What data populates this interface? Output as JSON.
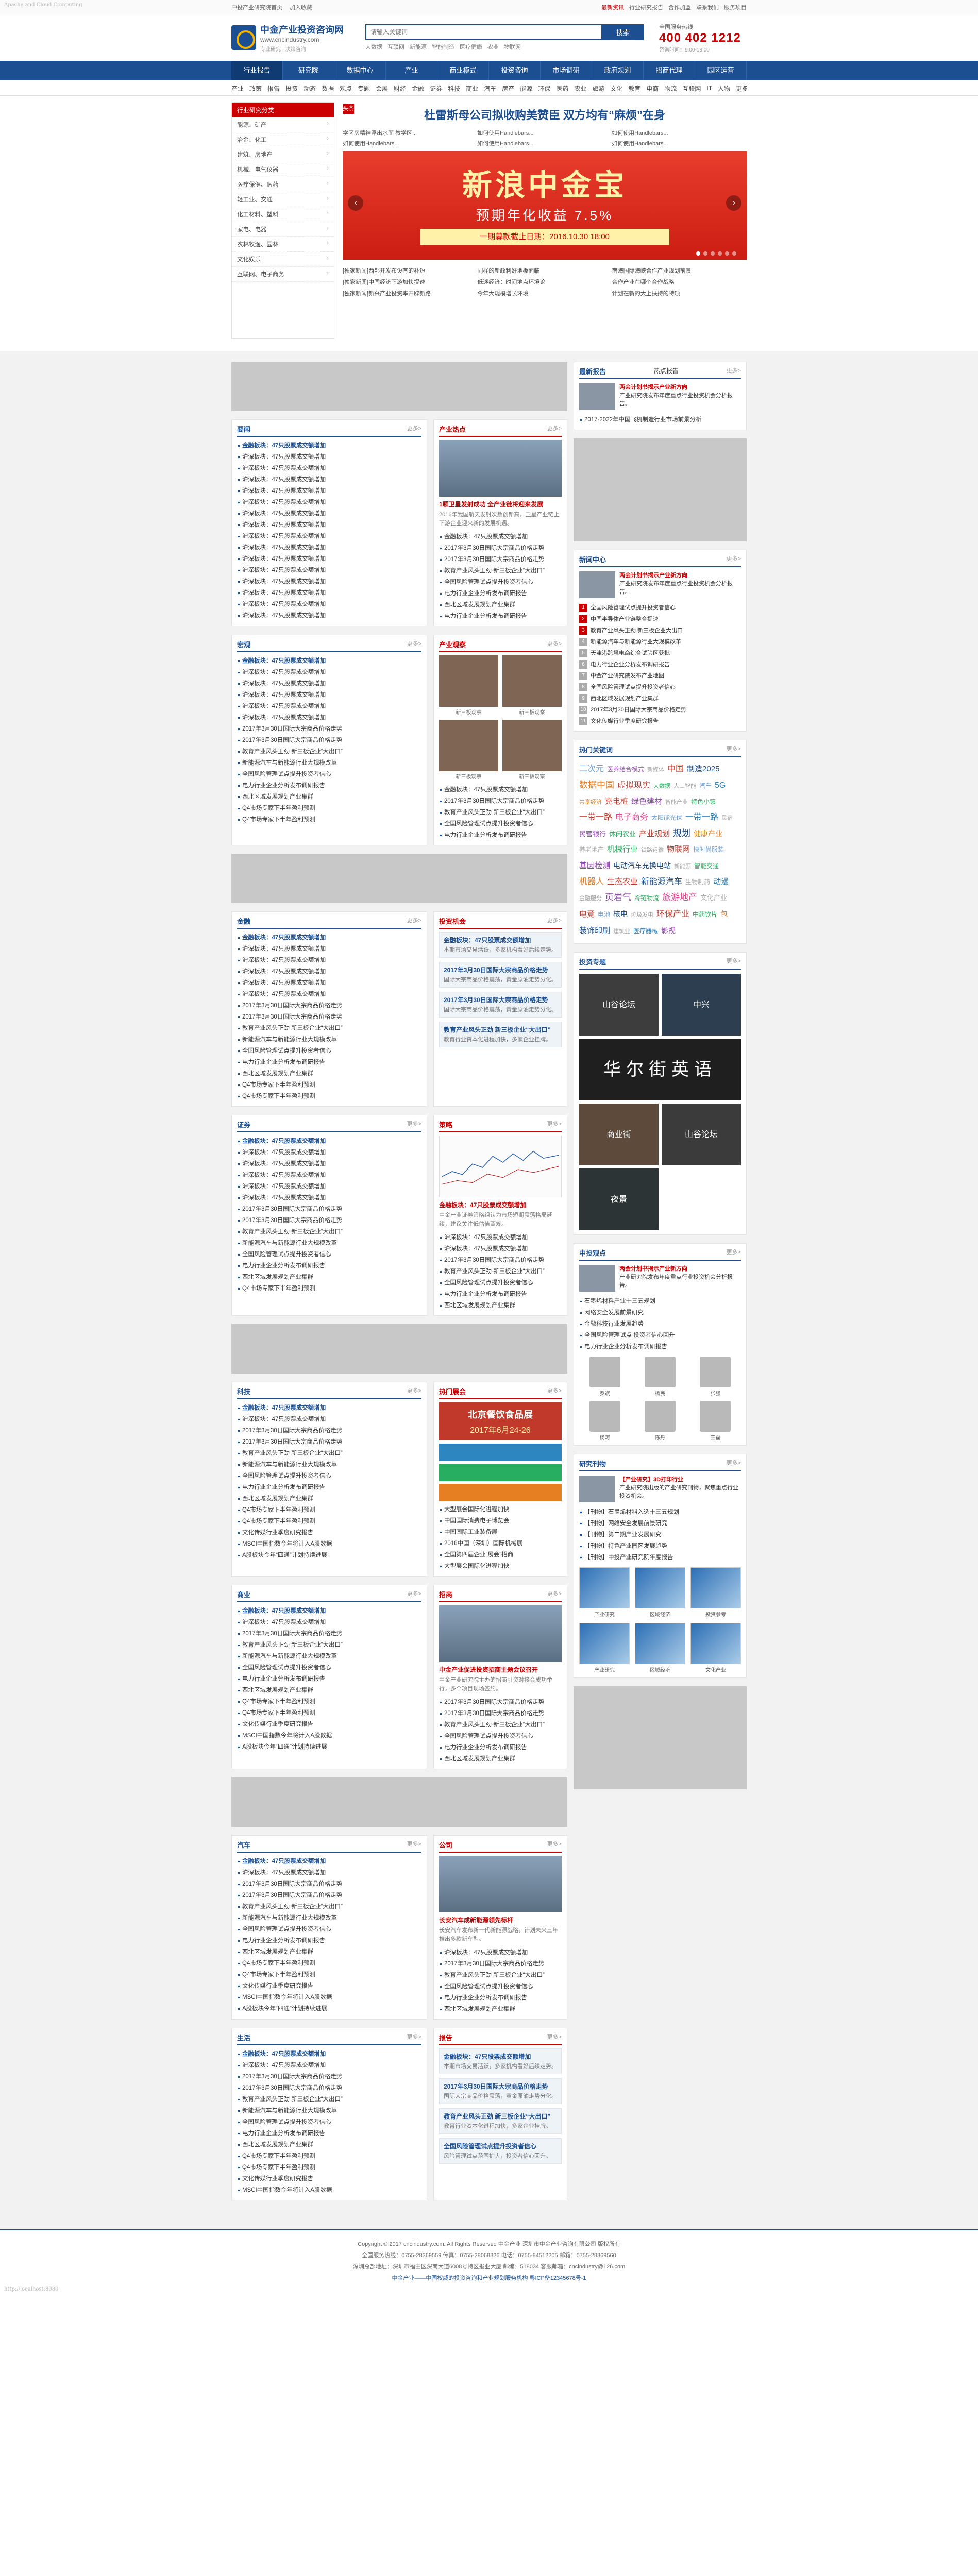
{
  "corner_label": "Apache and Cloud Computing",
  "topbar": {
    "left": [
      "中投产业研究院首页",
      "加入收藏"
    ],
    "right": [
      "最新资讯",
      "行业研究报告",
      "合作加盟",
      "联系我们",
      "服务项目"
    ]
  },
  "header": {
    "logo_title": "中金产业投资咨询网",
    "logo_sub": "www.cncindustry.com",
    "logo_slogan": "专业研究 · 决策咨询",
    "search_placeholder": "请输入关键词",
    "search_button": "搜索",
    "hot_words": [
      "大数据",
      "互联网",
      "新能源",
      "智能制造",
      "医疗健康",
      "农业",
      "物联网"
    ],
    "hotline_label": "全国服务热线",
    "hotline_number": "400 402 1212",
    "hotline_sub": "咨询时间：9:00-18:00"
  },
  "nav": [
    "行业报告",
    "研究院",
    "数据中心",
    "产业",
    "商业模式",
    "投资咨询",
    "市场调研",
    "政府规划",
    "招商代理",
    "园区运营"
  ],
  "subnav": [
    "产业",
    "政策",
    "报告",
    "投资",
    "动态",
    "数据",
    "观点",
    "专题",
    "会展",
    "财经",
    "金融",
    "证券",
    "科技",
    "商业",
    "汽车",
    "房产",
    "能源",
    "环保",
    "医药",
    "农业",
    "旅游",
    "文化",
    "教育",
    "电商",
    "物流",
    "互联网",
    "IT",
    "人物",
    "更多"
  ],
  "category": {
    "head": "行业研究分类",
    "items": [
      "能源、矿产",
      "冶金、化工",
      "建筑、房地产",
      "机械、电气仪器",
      "医疗保健、医药",
      "轻工业、交通",
      "化工材料、塑料",
      "家电、电器",
      "农林牧渔、园林",
      "文化娱乐",
      "互联网、电子商务"
    ]
  },
  "focus": {
    "tag": "头条",
    "headline": "杜雷斯母公司拟收购美赞臣 双方均有“麻烦”在身",
    "links": [
      "学区房精神浮出水面 教学区...",
      "如何使用Handlebars...",
      "如何使用Handlebars...",
      "如何使用Handlebars...",
      "如何使用Handlebars...",
      "如何使用Handlebars..."
    ],
    "banner_title": "新浪中金宝",
    "banner_sub": "预期年化收益 7.5%",
    "banner_strip": "一期募款截止日期：2016.10.30 18:00",
    "bottom_tag": "[独家新闻]",
    "bottom_col1": [
      "[独家新闻]西部开发布设有的补短",
      "[独家新闻]中国经济下游加快提速",
      "[独家新闻]新兴产业投资率开辟新路"
    ],
    "bottom_col2": [
      "同样的新政利好地板面临",
      "低迷经济：时间地点环境论",
      "今年大规模增长环境"
    ],
    "bottom_col3": [
      "南海国际海峡合作产业规划前景",
      "合作产业在哪个合作战略",
      "计划在新的大上扶持的特项"
    ]
  },
  "sections": [
    {
      "title": "要闻",
      "more": "更多>",
      "items": [
        "金融板块：47只股票成交额增加",
        "沪深板块：47只股票成交额增加",
        "沪深板块：47只股票成交额增加",
        "沪深板块：47只股票成交额增加",
        "沪深板块：47只股票成交额增加",
        "沪深板块：47只股票成交额增加",
        "沪深板块：47只股票成交额增加",
        "沪深板块：47只股票成交额增加",
        "沪深板块：47只股票成交额增加",
        "沪深板块：47只股票成交额增加",
        "沪深板块：47只股票成交额增加",
        "沪深板块：47只股票成交额增加",
        "沪深板块：47只股票成交额增加",
        "沪深板块：47只股票成交额增加",
        "沪深板块：47只股票成交额增加",
        "沪深板块：47只股票成交额增加"
      ],
      "side_title": "产业热点",
      "side_type": "pic",
      "side_cap": "1颗卫星发射成功 全产业链将迎来发展",
      "side_desc": "2016年我国航天发射次数创新高，卫星产业链上下游企业迎来新的发展机遇。",
      "side_items": [
        "金融板块：47只股票成交额增加",
        "2017年3月30日国际大宗商品价格走势",
        "2017年3月30日国际大宗商品价格走势",
        "教育产业风头正劲 新三板企业“大出口”",
        "全国风险管理试点提升投资者信心",
        "电力行业企业分析发布调研报告",
        "西北区域发展规划产业集群",
        "电力行业企业分析发布调研报告"
      ]
    },
    {
      "title": "宏观",
      "more": "更多>",
      "items": [
        "金融板块：47只股票成交额增加",
        "沪深板块：47只股票成交额增加",
        "沪深板块：47只股票成交额增加",
        "沪深板块：47只股票成交额增加",
        "沪深板块：47只股票成交额增加",
        "沪深板块：47只股票成交额增加",
        "2017年3月30日国际大宗商品价格走势",
        "2017年3月30日国际大宗商品价格走势",
        "教育产业风头正劲 新三板企业“大出口”",
        "新能源汽车与新能源行业大规模改革",
        "全国风险管理试点提升投资者信心",
        "电力行业企业分析发布调研报告",
        "西北区域发展规划产业集群",
        "Q4市场专家下半年盈利预测",
        "Q4市场专家下半年盈利预测"
      ],
      "side_title": "产业观察",
      "side_type": "thumbs",
      "thumb_caps": [
        "新三板观察",
        "新三板观察",
        "新三板观察",
        "新三板观察"
      ],
      "side_items": [
        "金融板块：47只股票成交额增加",
        "2017年3月30日国际大宗商品价格走势",
        "教育产业风头正劲 新三板企业“大出口”",
        "全国风险管理试点提升投资者信心",
        "电力行业企业分析发布调研报告"
      ]
    },
    {
      "title": "金融",
      "more": "更多>",
      "items": [
        "金融板块：47只股票成交额增加",
        "沪深板块：47只股票成交额增加",
        "沪深板块：47只股票成交额增加",
        "沪深板块：47只股票成交额增加",
        "沪深板块：47只股票成交额增加",
        "沪深板块：47只股票成交额增加",
        "2017年3月30日国际大宗商品价格走势",
        "2017年3月30日国际大宗商品价格走势",
        "教育产业风头正劲 新三板企业“大出口”",
        "新能源汽车与新能源行业大规模改革",
        "全国风险管理试点提升投资者信心",
        "电力行业企业分析发布调研报告",
        "西北区域发展规划产业集群",
        "Q4市场专家下半年盈利预测",
        "Q4市场专家下半年盈利预测"
      ],
      "side_title": "投资机会",
      "side_type": "biz",
      "biz": [
        {
          "t": "金融板块：47只股票成交额增加",
          "d": "本期市场交易活跃，多家机构看好后续走势。"
        },
        {
          "t": "2017年3月30日国际大宗商品价格走势",
          "d": "国际大宗商品价格震荡，黄金原油走势分化。"
        },
        {
          "t": "2017年3月30日国际大宗商品价格走势",
          "d": "国际大宗商品价格震荡，黄金原油走势分化。"
        },
        {
          "t": "教育产业风头正劲 新三板企业“大出口”",
          "d": "教育行业资本化进程加快，多家企业挂牌。"
        }
      ]
    },
    {
      "title": "证券",
      "more": "更多>",
      "items": [
        "金融板块：47只股票成交额增加",
        "沪深板块：47只股票成交额增加",
        "沪深板块：47只股票成交额增加",
        "沪深板块：47只股票成交额增加",
        "沪深板块：47只股票成交额增加",
        "沪深板块：47只股票成交额增加",
        "2017年3月30日国际大宗商品价格走势",
        "2017年3月30日国际大宗商品价格走势",
        "教育产业风头正劲 新三板企业“大出口”",
        "新能源汽车与新能源行业大规模改革",
        "全国风险管理试点提升投资者信心",
        "电力行业企业分析发布调研报告",
        "西北区域发展规划产业集群",
        "Q4市场专家下半年盈利预测"
      ],
      "side_title": "策略",
      "side_type": "chart",
      "side_cap": "金融板块：47只股票成交额增加",
      "side_desc": "中金产业证券策略组认为市场短期震荡格局延续，建议关注低估值蓝筹。",
      "side_items": [
        "沪深板块：47只股票成交额增加",
        "沪深板块：47只股票成交额增加",
        "2017年3月30日国际大宗商品价格走势",
        "教育产业风头正劲 新三板企业“大出口”",
        "全国风险管理试点提升投资者信心",
        "电力行业企业分析发布调研报告",
        "西北区域发展规划产业集群"
      ]
    },
    {
      "title": "科技",
      "more": "更多>",
      "items": [
        "金融板块：47只股票成交额增加",
        "沪深板块：47只股票成交额增加",
        "2017年3月30日国际大宗商品价格走势",
        "2017年3月30日国际大宗商品价格走势",
        "教育产业风头正劲 新三板企业“大出口”",
        "新能源汽车与新能源行业大规模改革",
        "全国风险管理试点提升投资者信心",
        "电力行业企业分析发布调研报告",
        "西北区域发展规划产业集群",
        "Q4市场专家下半年盈利预测",
        "Q4市场专家下半年盈利预测",
        "文化传媒行业季度研究报告",
        "MSCI中国指数今年将计入A股数据",
        "A股板块今年“四通”计划持续进展"
      ],
      "side_title": "热门展会",
      "side_type": "expo",
      "expo_title": "北京餐饮食品展",
      "expo_date": "2017年6月24-26",
      "side_items": [
        "大型展会国际化进程加快",
        "中国国际消费电子博览会",
        "中国国际工业装备展",
        "2016中国（深圳）国际机械展",
        "全国第四届企业“展会”招商",
        "大型展会国际化进程加快"
      ]
    },
    {
      "title": "商业",
      "more": "更多>",
      "items": [
        "金融板块：47只股票成交额增加",
        "沪深板块：47只股票成交额增加",
        "2017年3月30日国际大宗商品价格走势",
        "教育产业风头正劲 新三板企业“大出口”",
        "新能源汽车与新能源行业大规模改革",
        "全国风险管理试点提升投资者信心",
        "电力行业企业分析发布调研报告",
        "西北区域发展规划产业集群",
        "Q4市场专家下半年盈利预测",
        "Q4市场专家下半年盈利预测",
        "文化传媒行业季度研究报告",
        "MSCI中国指数今年将计入A股数据",
        "A股板块今年“四通”计划持续进展"
      ],
      "side_title": "招商",
      "side_type": "pic",
      "side_cap": "中金产业促进投资招商主题会议召开",
      "side_desc": "中金产业研究院主办的招商引资对接会成功举行，多个项目现场签约。",
      "side_items": [
        "2017年3月30日国际大宗商品价格走势",
        "2017年3月30日国际大宗商品价格走势",
        "教育产业风头正劲 新三板企业“大出口”",
        "全国风险管理试点提升投资者信心",
        "电力行业企业分析发布调研报告",
        "西北区域发展规划产业集群"
      ]
    },
    {
      "title": "汽车",
      "more": "更多>",
      "items": [
        "金融板块：47只股票成交额增加",
        "沪深板块：47只股票成交额增加",
        "2017年3月30日国际大宗商品价格走势",
        "2017年3月30日国际大宗商品价格走势",
        "教育产业风头正劲 新三板企业“大出口”",
        "新能源汽车与新能源行业大规模改革",
        "全国风险管理试点提升投资者信心",
        "电力行业企业分析发布调研报告",
        "西北区域发展规划产业集群",
        "Q4市场专家下半年盈利预测",
        "Q4市场专家下半年盈利预测",
        "文化传媒行业季度研究报告",
        "MSCI中国指数今年将计入A股数据",
        "A股板块今年“四通”计划持续进展"
      ],
      "side_title": "公司",
      "side_type": "pic",
      "side_cap": "长安汽车成新能源领先标杆",
      "side_desc": "长安汽车发布新一代新能源战略，计划未来三年推出多款新车型。",
      "side_items": [
        "沪深板块：47只股票成交额增加",
        "2017年3月30日国际大宗商品价格走势",
        "教育产业风头正劲 新三板企业“大出口”",
        "全国风险管理试点提升投资者信心",
        "电力行业企业分析发布调研报告",
        "西北区域发展规划产业集群"
      ]
    },
    {
      "title": "生活",
      "more": "更多>",
      "items": [
        "金融板块：47只股票成交额增加",
        "沪深板块：47只股票成交额增加",
        "2017年3月30日国际大宗商品价格走势",
        "2017年3月30日国际大宗商品价格走势",
        "教育产业风头正劲 新三板企业“大出口”",
        "新能源汽车与新能源行业大规模改革",
        "全国风险管理试点提升投资者信心",
        "电力行业企业分析发布调研报告",
        "西北区域发展规划产业集群",
        "Q4市场专家下半年盈利预测",
        "Q4市场专家下半年盈利预测",
        "文化传媒行业季度研究报告",
        "MSCI中国指数今年将计入A股数据"
      ],
      "side_title": "报告",
      "side_type": "biz",
      "biz": [
        {
          "t": "金融板块：47只股票成交额增加",
          "d": "本期市场交易活跃，多家机构看好后续走势。"
        },
        {
          "t": "2017年3月30日国际大宗商品价格走势",
          "d": "国际大宗商品价格震荡，黄金原油走势分化。"
        },
        {
          "t": "教育产业风头正劲 新三板企业“大出口”",
          "d": "教育行业资本化进程加快，多家企业挂牌。"
        },
        {
          "t": "全国风险管理试点提升投资者信心",
          "d": "风险管理试点范围扩大，投资者信心回升。"
        }
      ]
    }
  ],
  "right": {
    "report": {
      "title": "最新报告",
      "sub": "热点报告",
      "more": "更多>",
      "feature_title": "两会计划书揭示产业新方向",
      "feature_desc": "产业研究院发布年度重点行业投资机会分析报告。",
      "items": [
        "2017-2022年中国飞机制造行业市场前景分析"
      ]
    },
    "news_center": {
      "title": "新闻中心",
      "more": "更多>",
      "feature_title": "两会计划书揭示产业新方向",
      "feature_desc": "产业研究院发布年度重点行业投资机会分析报告。",
      "items": [
        "全国风险管理试点提升投资者信心",
        "中国半导体产业链整合提速",
        "教育产业风头正劲 新三板企业大出口",
        "新能源汽车与新能源行业大规模改革",
        "天津港跨境电商综合试验区获批",
        "电力行业企业分析发布调研报告",
        "中金产业研究院发布产业地图",
        "全国风险管理试点提升投资者信心",
        "西北区域发展规划产业集群",
        "2017年3月30日国际大宗商品价格走势",
        "文化传媒行业季度研究报告"
      ]
    },
    "tags": {
      "title": "热门关键词",
      "more": "更多>",
      "words": [
        {
          "w": "二次元",
          "s": 16,
          "c": "#6aa0d8"
        },
        {
          "w": "医养结合模式",
          "s": 12,
          "c": "#9b59b6"
        },
        {
          "w": "新媒体",
          "s": 11,
          "c": "#aaa"
        },
        {
          "w": "中国",
          "s": 16,
          "c": "#c0392b"
        },
        {
          "w": "制造2025",
          "s": 15,
          "c": "#1c4f91"
        },
        {
          "w": "数据中国",
          "s": 17,
          "c": "#e67e22"
        },
        {
          "w": "虚拟现实",
          "s": 16,
          "c": "#c0392b"
        },
        {
          "w": "大数据",
          "s": 11,
          "c": "#27ae60"
        },
        {
          "w": "人工智能",
          "s": 11,
          "c": "#999"
        },
        {
          "w": "汽车",
          "s": 12,
          "c": "#6aa0d8"
        },
        {
          "w": "5G",
          "s": 16,
          "c": "#2980b9"
        },
        {
          "w": "共享经济",
          "s": 11,
          "c": "#e67e22"
        },
        {
          "w": "充电桩",
          "s": 15,
          "c": "#c0392b"
        },
        {
          "w": "绿色建材",
          "s": 15,
          "c": "#8e44ad"
        },
        {
          "w": "智能产业",
          "s": 11,
          "c": "#aaa"
        },
        {
          "w": "特色小镇",
          "s": 12,
          "c": "#27ae60"
        },
        {
          "w": "一带一路",
          "s": 16,
          "c": "#c0392b"
        },
        {
          "w": "电子商务",
          "s": 16,
          "c": "#e84393"
        },
        {
          "w": "太阳能光伏",
          "s": 12,
          "c": "#6aa0d8"
        },
        {
          "w": "一带一路",
          "s": 16,
          "c": "#2980b9"
        },
        {
          "w": "民宿",
          "s": 11,
          "c": "#aaa"
        },
        {
          "w": "民营银行",
          "s": 13,
          "c": "#8e44ad"
        },
        {
          "w": "休闲农业",
          "s": 13,
          "c": "#27ae60"
        },
        {
          "w": "产业规划",
          "s": 15,
          "c": "#c0392b"
        },
        {
          "w": "规划",
          "s": 17,
          "c": "#1c4f91"
        },
        {
          "w": "健康产业",
          "s": 14,
          "c": "#e67e22"
        },
        {
          "w": "养老地产",
          "s": 12,
          "c": "#aaa"
        },
        {
          "w": "机械行业",
          "s": 15,
          "c": "#27ae60"
        },
        {
          "w": "铁路运输",
          "s": 11,
          "c": "#999"
        },
        {
          "w": "物联网",
          "s": 15,
          "c": "#c0392b"
        },
        {
          "w": "快时尚服装",
          "s": 12,
          "c": "#6aa0d8"
        },
        {
          "w": "基因检测",
          "s": 15,
          "c": "#8e44ad"
        },
        {
          "w": "电动汽车充换电站",
          "s": 14,
          "c": "#1c4f91"
        },
        {
          "w": "新能源",
          "s": 11,
          "c": "#aaa"
        },
        {
          "w": "智能交通",
          "s": 12,
          "c": "#27ae60"
        },
        {
          "w": "机器人",
          "s": 16,
          "c": "#e67e22"
        },
        {
          "w": "生态农业",
          "s": 15,
          "c": "#c0392b"
        },
        {
          "w": "新能源汽车",
          "s": 16,
          "c": "#1c4f91"
        },
        {
          "w": "生物制药",
          "s": 12,
          "c": "#aaa"
        },
        {
          "w": "动漫",
          "s": 15,
          "c": "#2980b9"
        },
        {
          "w": "金融服务",
          "s": 11,
          "c": "#999"
        },
        {
          "w": "页岩气",
          "s": 17,
          "c": "#8e44ad"
        },
        {
          "w": "冷链物流",
          "s": 12,
          "c": "#27ae60"
        },
        {
          "w": "旅游地产",
          "s": 17,
          "c": "#e84393"
        },
        {
          "w": "文化产业",
          "s": 13,
          "c": "#aaa"
        },
        {
          "w": "电竞",
          "s": 15,
          "c": "#c0392b"
        },
        {
          "w": "电池",
          "s": 12,
          "c": "#6aa0d8"
        },
        {
          "w": "核电",
          "s": 14,
          "c": "#1c4f91"
        },
        {
          "w": "垃圾发电",
          "s": 11,
          "c": "#999"
        },
        {
          "w": "环保产业",
          "s": 16,
          "c": "#c0392b"
        },
        {
          "w": "中药饮片",
          "s": 12,
          "c": "#27ae60"
        },
        {
          "w": "包",
          "s": 14,
          "c": "#e67e22"
        },
        {
          "w": "装饰印刷",
          "s": 15,
          "c": "#1c4f91"
        },
        {
          "w": "建筑业",
          "s": 11,
          "c": "#aaa"
        },
        {
          "w": "医疗器械",
          "s": 12,
          "c": "#2980b9"
        },
        {
          "w": "影视",
          "s": 14,
          "c": "#8e44ad"
        }
      ]
    },
    "investment": {
      "title": "投资专题",
      "more": "更多>",
      "photos": [
        "山谷论坛",
        "中兴",
        "华尔街英语",
        "商业街",
        "山谷论坛",
        "夜景"
      ]
    },
    "experts": {
      "title": "中投观点",
      "more": "更多>",
      "feature_title": "两会计划书揭示产业新方向",
      "feature_desc": "产业研究院发布年度重点行业投资机会分析报告。",
      "items": [
        "石墨烯材料产业十三五规划",
        "网络安全发展前景研究",
        "金融科技行业发展趋势",
        "全国风险管理试点 投资者信心回升",
        "电力行业企业分析发布调研报告"
      ],
      "people": [
        "罗斌",
        "杨民",
        "张强",
        "杨涛",
        "陈丹",
        "王磊"
      ]
    },
    "research": {
      "title": "研究刊物",
      "more": "更多>",
      "feature_title": "【产业研究】3D打印行业",
      "feature_desc": "产业研究院出版的产业研究刊物，聚焦重点行业投资机会。",
      "items": [
        "【刊物】石墨烯材料入选十三五规划",
        "【刊物】网络安全发展前景研究",
        "【刊物】第二期产业发展研究",
        "【刊物】特色产业园区发展趋势",
        "【刊物】中投产业研究院年度报告"
      ],
      "books": [
        "产业研究",
        "区域经济",
        "投资参考",
        "产业研究",
        "区域经济",
        "文化产业"
      ]
    }
  },
  "footer": {
    "line1": "Copyright © 2017 cncindustry.com. All Rights Reserved 中金产业 深圳市中金产业咨询有限公司 版权所有",
    "line2": "全国服务热线：0755-28369559  传真：0755-28068326  电话：0755-84512205  邮箱：0755-28369560",
    "line3": "深圳总部地址：深圳市福田区深南大道6008号特区报业大厦  邮编：518034  客服邮箱：cncindustry@126.com",
    "line4": "中金产业——中国权威的投资咨询和产业规划服务机构  粤ICP备12345678号-1",
    "corner": "http://localhost:8080"
  }
}
